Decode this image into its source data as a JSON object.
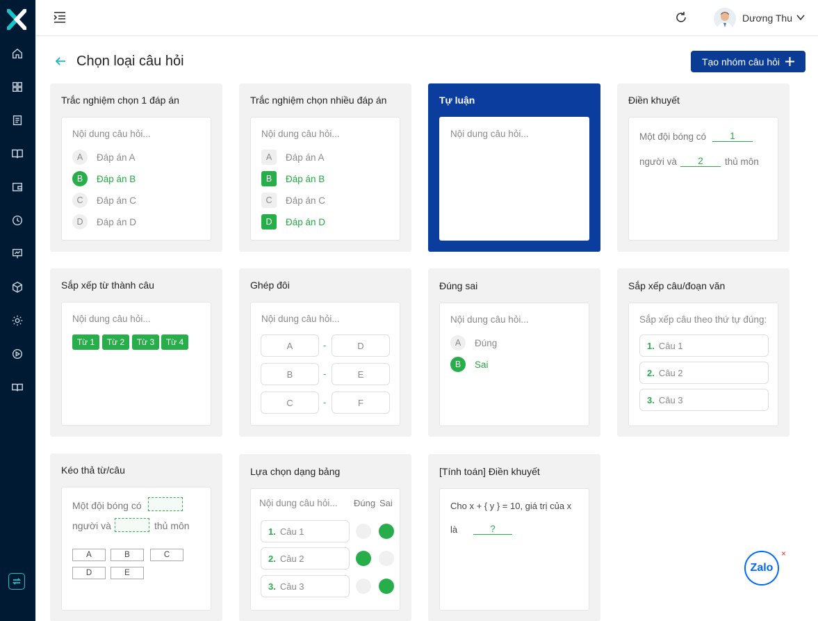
{
  "user": {
    "name": "Dương Thu"
  },
  "page": {
    "title": "Chọn loại câu hỏi",
    "create_label": "Tạo nhóm câu hỏi"
  },
  "placeholder": "Nội dung câu hỏi...",
  "cards": {
    "single": {
      "title": "Trắc nghiệm chọn 1 đáp án",
      "options": [
        {
          "letter": "A",
          "text": "Đáp án A"
        },
        {
          "letter": "B",
          "text": "Đáp án B"
        },
        {
          "letter": "C",
          "text": "Đáp án C"
        },
        {
          "letter": "D",
          "text": "Đáp án D"
        }
      ]
    },
    "multi": {
      "title": "Trắc nghiệm chọn nhiều đáp án",
      "options": [
        {
          "letter": "A",
          "text": "Đáp án A"
        },
        {
          "letter": "B",
          "text": "Đáp án B"
        },
        {
          "letter": "C",
          "text": "Đáp án C"
        },
        {
          "letter": "D",
          "text": "Đáp án D"
        }
      ]
    },
    "essay": {
      "title": "Tự luận"
    },
    "fill": {
      "title": "Điền khuyết",
      "line1": "Một đội bóng có",
      "val1": "1",
      "line2": "người và",
      "val2": "2",
      "line3": "thủ môn"
    },
    "arrange_words": {
      "title": "Sắp xếp từ thành câu",
      "words": [
        "Từ 1",
        "Từ 2",
        "Từ 3",
        "Từ 4"
      ]
    },
    "match": {
      "title": "Ghép đôi",
      "left": [
        "A",
        "B",
        "C"
      ],
      "right": [
        "D",
        "E",
        "F"
      ],
      "sep": "-"
    },
    "truefalse": {
      "title": "Đúng sai",
      "options": [
        {
          "letter": "A",
          "text": "Đúng"
        },
        {
          "letter": "B",
          "text": "Sai"
        }
      ]
    },
    "arrange_sentences": {
      "title": "Sắp xếp câu/đoạn văn",
      "hint": "Sắp xếp câu theo thứ tự đúng:",
      "items": [
        {
          "num": "1.",
          "text": "Câu 1"
        },
        {
          "num": "2.",
          "text": "Câu 2"
        },
        {
          "num": "3.",
          "text": "Câu 3"
        }
      ]
    },
    "dragdrop": {
      "title": "Kéo thả từ/câu",
      "line1": "Một đội bóng có",
      "line2": "người và",
      "line3": "thủ môn",
      "chips": [
        "A",
        "B",
        "C",
        "D",
        "E"
      ]
    },
    "table": {
      "title": "Lựa chọn dạng bảng",
      "col_true": "Đúng",
      "col_false": "Sai",
      "rows": [
        {
          "num": "1.",
          "text": "Câu 1"
        },
        {
          "num": "2.",
          "text": "Câu 2"
        },
        {
          "num": "3.",
          "text": "Câu 3"
        }
      ]
    },
    "calc": {
      "title": "[Tính toán] Điền khuyết",
      "text1": "Cho x + { y } = 10, giá trị của x",
      "text2": "là",
      "val": "?"
    }
  },
  "zalo": {
    "label": "Zalo",
    "close": "×"
  }
}
